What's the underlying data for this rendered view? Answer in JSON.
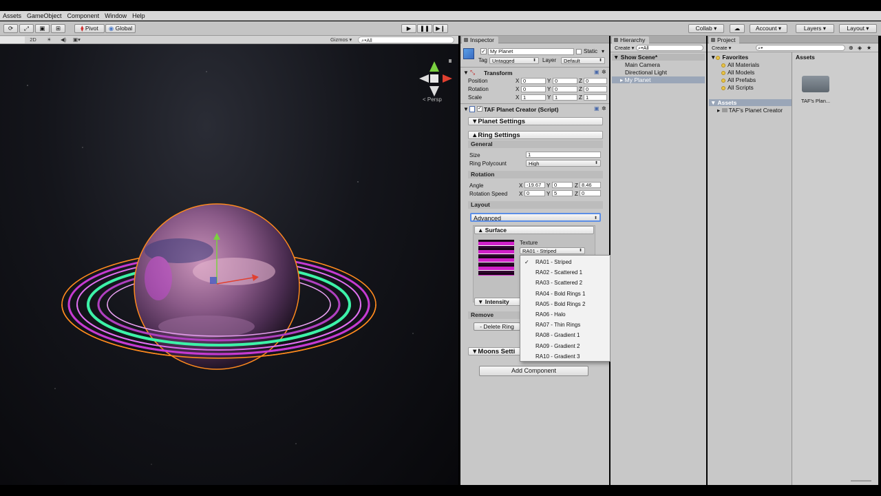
{
  "menubar": [
    "Assets",
    "GameObject",
    "Component",
    "Window",
    "Help"
  ],
  "toolbar": {
    "pivot": "Pivot",
    "global": "Global",
    "collab": "Collab ▾",
    "account": "Account",
    "layers": "Layers",
    "layout": "Layout"
  },
  "scene": {
    "mode2d": "2D",
    "gizmos": "Gizmos",
    "search": "All",
    "persp": "< Persp"
  },
  "inspector": {
    "tab": "Inspector",
    "object_name": "My Planet",
    "static": "Static",
    "tag_label": "Tag",
    "tag_value": "Untagged",
    "layer_label": "Layer",
    "layer_value": "Default",
    "transform": {
      "title": "Transform",
      "rows": [
        {
          "label": "Position",
          "x": "0",
          "y": "0",
          "z": "0"
        },
        {
          "label": "Rotation",
          "x": "0",
          "y": "0",
          "z": "0"
        },
        {
          "label": "Scale",
          "x": "1",
          "y": "1",
          "z": "1"
        }
      ]
    },
    "script_title": "TAF Planet Creator (Script)",
    "planet_settings": "▼Planet Settings",
    "ring_settings": "▲Ring Settings",
    "general": "General",
    "size_label": "Size",
    "size_value": "1",
    "polycount_label": "Ring Polycount",
    "polycount_value": "High",
    "rotation_section": "Rotation",
    "angle_label": "Angle",
    "angle": {
      "x": "-19.67",
      "y": "0",
      "z": "8.46"
    },
    "rotspeed_label": "Rotation Speed",
    "rotspeed": {
      "x": "0",
      "y": "5",
      "z": "0"
    },
    "layout_section": "Layout",
    "layout_value": "Advanced",
    "surface": "▲ Surface",
    "texture_label": "Texture",
    "texture_value": "RA01 - Striped",
    "intensity": "▼ Intensity",
    "remove": "Remove",
    "delete_ring": "- Delete Ring",
    "moons_settings": "▼Moons Setti",
    "add_component": "Add Component"
  },
  "texture_options": [
    {
      "label": "RA01 - Striped",
      "checked": true
    },
    {
      "label": "RA02 - Scattered 1",
      "checked": false
    },
    {
      "label": "RA03 - Scattered 2",
      "checked": false
    },
    {
      "label": "RA04 - Bold Rings 1",
      "checked": false
    },
    {
      "label": "RA05 - Bold Rings 2",
      "checked": false
    },
    {
      "label": "RA06 - Halo",
      "checked": false
    },
    {
      "label": "RA07 - Thin Rings",
      "checked": false
    },
    {
      "label": "RA08 - Gradient 1",
      "checked": false
    },
    {
      "label": "RA09 - Gradient 2",
      "checked": false
    },
    {
      "label": "RA10 - Gradient 3",
      "checked": false
    }
  ],
  "hierarchy": {
    "tab": "Hierarchy",
    "create": "Create ▾",
    "search": "All",
    "scene": "Show Scene*",
    "items": [
      "Main Camera",
      "Directional Light",
      "My Planet"
    ]
  },
  "project": {
    "tab": "Project",
    "create": "Create ▾",
    "favorites": "Favorites",
    "fav_items": [
      "All Materials",
      "All Models",
      "All Prefabs",
      "All Scripts"
    ],
    "assets": "Assets",
    "asset_children": [
      "TAF's Planet Creator"
    ],
    "assets_header": "Assets",
    "folder_label": "TAF's Plan..."
  },
  "colors": {
    "selection": "#3e7ce0",
    "ring_outline": "#ff8a1e",
    "ring_green": "#3df2a8",
    "ring_magenta": "#c63ad2"
  }
}
